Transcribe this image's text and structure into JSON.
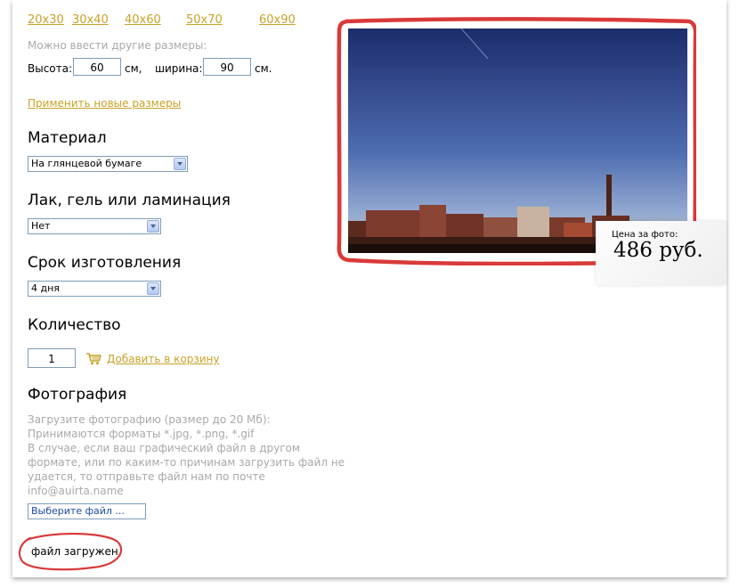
{
  "sizes": [
    "20x30",
    "30x40",
    "40x60",
    "50x70",
    "60x90"
  ],
  "custom": {
    "hint": "Можно ввести другие размеры:",
    "height_label": "Высота:",
    "height_value": "60",
    "unit": "см,",
    "width_label": "ширина:",
    "width_value": "90",
    "unit2": "см.",
    "apply_link": "Применить новые размеры"
  },
  "material": {
    "title": "Материал",
    "selected": "На глянцевой бумаге"
  },
  "coating": {
    "title": "Лак, гель или ламинация",
    "selected": "Нет"
  },
  "deadline": {
    "title": "Срок изготовления",
    "selected": "4 дня"
  },
  "quantity": {
    "title": "Количество",
    "value": "1",
    "add_to_cart": "Добавить в корзину"
  },
  "photo": {
    "title": "Фотография",
    "info": [
      "Загрузите фотографию (размер до 20 Мб):",
      "Принимаются форматы *.jpg, *.png, *.gif",
      "В случае, если ваш графический файл в другом",
      "формате, или по каким-то причинам загрузить файл не",
      "удается, то отправьте файл нам по почте",
      "info@auirta.name"
    ],
    "choose_file": "Выберите файл ...",
    "uploaded": "файл загружен"
  },
  "price": {
    "label": "Цена за фото:",
    "value": "486 руб."
  },
  "colors": {
    "link_gold": "#c9a227",
    "hint_gray": "#a9a9a9",
    "marker_red": "#d93a3a",
    "input_border": "#7f9db9"
  }
}
